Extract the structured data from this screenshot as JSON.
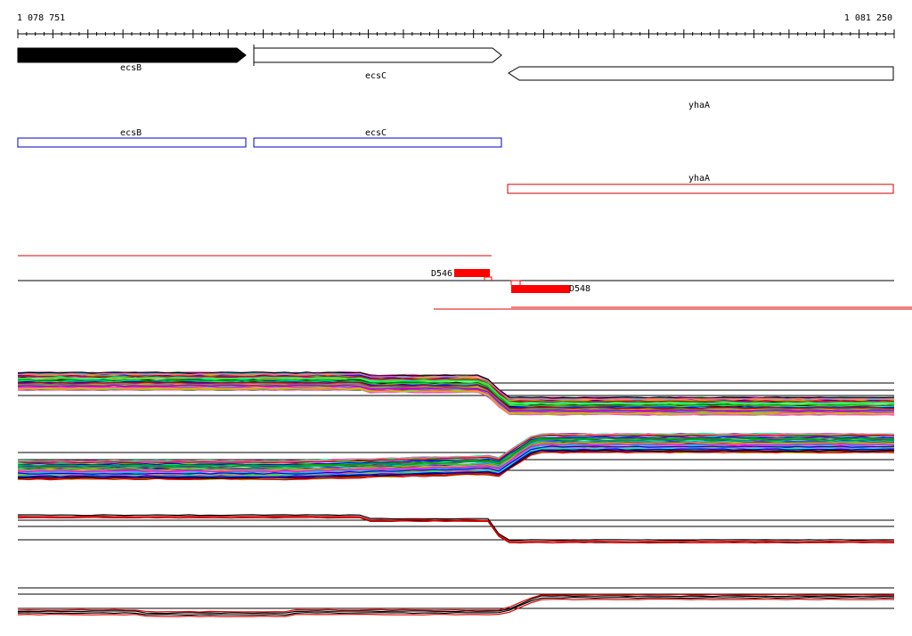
{
  "ruler": {
    "start_label": "1 078 751",
    "end_label": "1 081 250"
  },
  "genes": [
    {
      "id": "gene-ecsB",
      "label": "ecsB",
      "strand": "+",
      "fill": "#000000"
    },
    {
      "id": "gene-ecsC",
      "label": "ecsC",
      "strand": "+",
      "fill": "#ffffff"
    },
    {
      "id": "gene-yhaA",
      "label": "yhaA",
      "strand": "-",
      "fill": "#ffffff"
    }
  ],
  "gene_boxes": [
    {
      "id": "box-ecsB",
      "label": "ecsB",
      "color": "#0000cc"
    },
    {
      "id": "box-ecsC",
      "label": "ecsC",
      "color": "#0000cc"
    },
    {
      "id": "box-yhaA",
      "label": "yhaA",
      "color": "#cc0000"
    }
  ],
  "features": [
    {
      "id": "feature-D546",
      "label": "D546",
      "color": "#ff0000"
    },
    {
      "id": "feature-D548",
      "label": "D548",
      "color": "#ff0000"
    }
  ],
  "colors": {
    "gene_outline": "#000000",
    "forward_box": "#0000cc",
    "reverse_box": "#cc0000",
    "feature": "#ff0000",
    "track_line": "#000000",
    "profile_palette": [
      "#ff00ff",
      "#00aa00",
      "#0000ff",
      "#ffaa00",
      "#00cccc",
      "#aa00aa",
      "#777777",
      "#88cc00",
      "#cc0000",
      "#000000",
      "#00ff88",
      "#ff66aa"
    ]
  }
}
